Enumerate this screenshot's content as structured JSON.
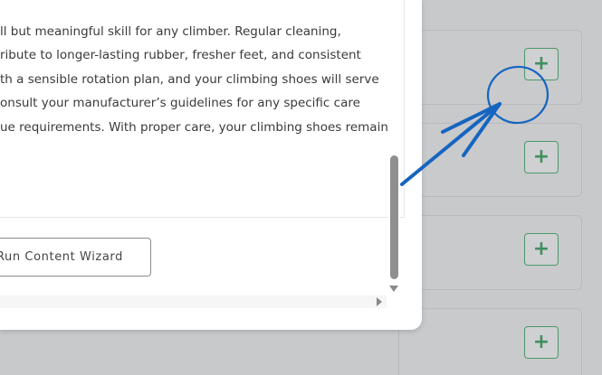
{
  "article": {
    "lines": [
      "ll but meaningful skill for any climber. Regular cleaning,",
      "ribute to longer-lasting rubber, fresher feet, and consistent",
      "th a sensible rotation plan, and your climbing shoes will serve",
      "onsult your manufacturer’s guidelines for any specific care",
      "ue requirements. With proper care, your climbing shoes remain"
    ]
  },
  "wizard_button": {
    "label": "-Run Content Wizard"
  },
  "add_buttons": {
    "symbol": "+"
  },
  "colors": {
    "overlay": "#c8c9cb",
    "accent_green": "#3f8f60",
    "annotation_blue": "#1565c0",
    "scroll_thumb": "#8f8f8f"
  },
  "icons": {
    "add": "plus-icon",
    "annotation": "arrow-circle-annotation"
  }
}
